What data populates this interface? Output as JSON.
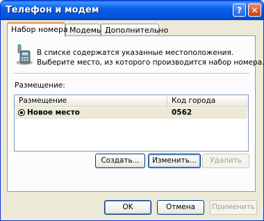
{
  "window": {
    "title": "Телефон и модем"
  },
  "titlebar": {
    "help_glyph": "?",
    "close_glyph": "✕"
  },
  "tabs": [
    {
      "label": "Набор номера",
      "active": true
    },
    {
      "label": "Модемы",
      "active": false
    },
    {
      "label": "Дополнительно",
      "active": false
    }
  ],
  "dialing": {
    "info_line1": "В списке содержатся указанные местоположения.",
    "info_line2": "Выберите место, из которого производится набор номера.",
    "locations_label": "Размещение:",
    "columns": [
      "Размещение",
      "Код города"
    ],
    "rows": [
      {
        "location": "Новое место",
        "area_code": "0562",
        "selected": true
      }
    ],
    "buttons": {
      "new": "Создать...",
      "edit": "Изменить...",
      "delete": "Удалить"
    }
  },
  "footer": {
    "ok": "OK",
    "cancel": "Отмена",
    "apply": "Применить"
  },
  "colors": {
    "title_bar": "#0a5ee8",
    "dialog_bg": "#ece9d8",
    "tab_accent": "#e68b2c"
  }
}
